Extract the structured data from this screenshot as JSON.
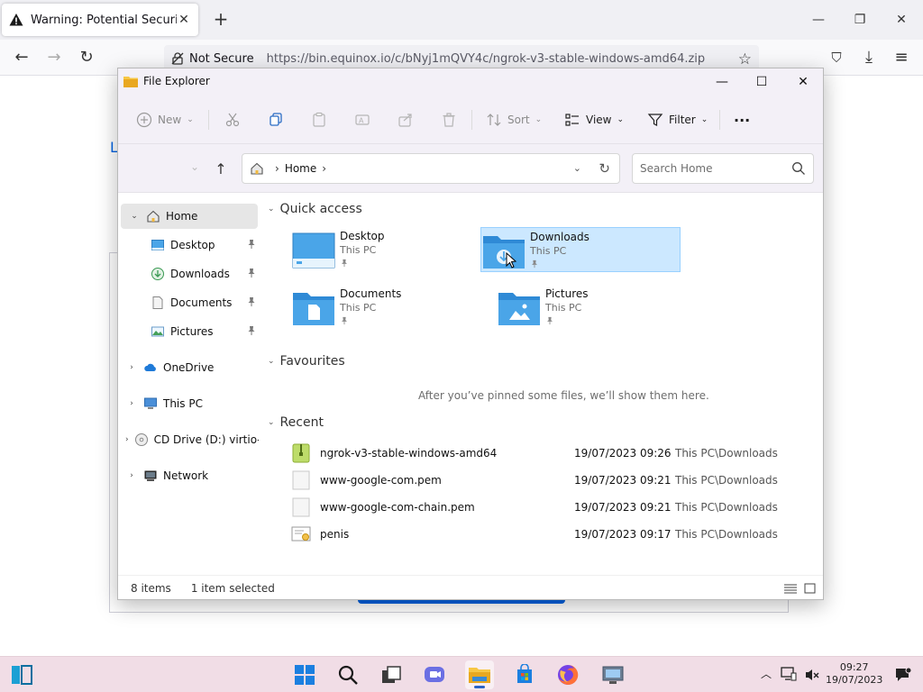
{
  "browser": {
    "tab_title": "Warning: Potential Security Risk",
    "new_tab_label": "+",
    "url_security_label": "Not Secure",
    "url": "https://bin.equinox.io/c/bNyj1mQVY4c/ngrok-v3-stable-windows-amd64.zip",
    "page_letter": "L"
  },
  "explorer": {
    "title": "File Explorer",
    "toolbar": {
      "new_label": "New",
      "sort_label": "Sort",
      "view_label": "View",
      "filter_label": "Filter",
      "more_label": "···"
    },
    "address": {
      "crumb": "Home",
      "search_placeholder": "Search Home"
    },
    "nav": {
      "home": "Home",
      "desktop": "Desktop",
      "downloads": "Downloads",
      "documents": "Documents",
      "pictures": "Pictures",
      "onedrive": "OneDrive",
      "thispc": "This PC",
      "cddrive": "CD Drive (D:) virtio-win",
      "network": "Network"
    },
    "sections": {
      "quick_access": "Quick access",
      "favourites": "Favourites",
      "recent": "Recent",
      "favourites_empty": "After you’ve pinned some files, we’ll show them here."
    },
    "quick_access": [
      {
        "name": "Desktop",
        "location": "This PC"
      },
      {
        "name": "Downloads",
        "location": "This PC"
      },
      {
        "name": "Documents",
        "location": "This PC"
      },
      {
        "name": "Pictures",
        "location": "This PC"
      }
    ],
    "recent": [
      {
        "name": "ngrok-v3-stable-windows-amd64",
        "date": "19/07/2023 09:26",
        "location": "This PC\\Downloads",
        "icon": "zip-icon"
      },
      {
        "name": "www-google-com.pem",
        "date": "19/07/2023 09:21",
        "location": "This PC\\Downloads",
        "icon": "file-icon"
      },
      {
        "name": "www-google-com-chain.pem",
        "date": "19/07/2023 09:21",
        "location": "This PC\\Downloads",
        "icon": "file-icon"
      },
      {
        "name": "penis",
        "date": "19/07/2023 09:17",
        "location": "This PC\\Downloads",
        "icon": "certificate-icon"
      }
    ],
    "status": {
      "items": "8 items",
      "selected": "1 item selected"
    }
  },
  "taskbar": {
    "time": "09:27",
    "date": "19/07/2023"
  },
  "colors": {
    "folder_blue": "#4aa5e8",
    "selection": "#cce8ff",
    "taskbar_bg": "#f1dde6",
    "accent": "#0061e0"
  }
}
